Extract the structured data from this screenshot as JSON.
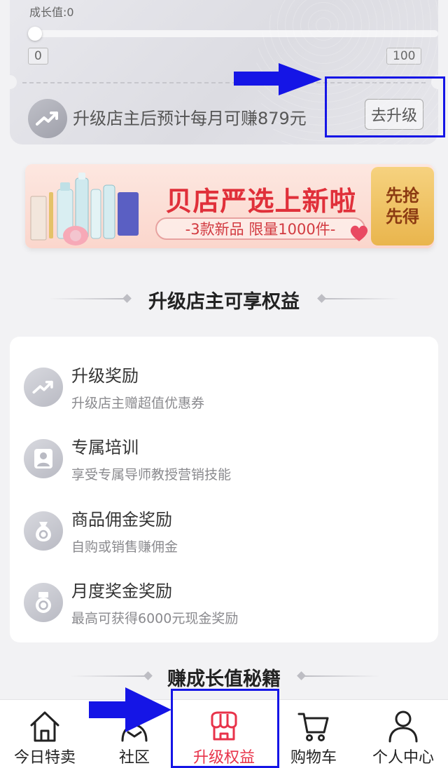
{
  "growth": {
    "label": "成长值:0",
    "value": 0,
    "scale_min": "0",
    "scale_max": "100",
    "earn_text": "升级店主后预计每月可赚879元",
    "upgrade_label": "去升级"
  },
  "banner": {
    "title": "贝店严选上新啦",
    "subtitle": "-3款新品 限量1000件-",
    "ticket": "先抢\n先得",
    "ticket_line1": "先抢",
    "ticket_line2": "先得"
  },
  "benefits_section": {
    "title": "升级店主可享权益",
    "items": [
      {
        "title": "升级奖励",
        "desc": "升级店主赠超值优惠券",
        "icon": "trend-up-icon"
      },
      {
        "title": "专属培训",
        "desc": "享受专属导师教授营销技能",
        "icon": "person-icon"
      },
      {
        "title": "商品佣金奖励",
        "desc": "自购或销售赚佣金",
        "icon": "money-bag-icon"
      },
      {
        "title": "月度奖金奖励",
        "desc": "最高可获得6000元现金奖励",
        "icon": "medal-icon"
      }
    ]
  },
  "secrets_section": {
    "title": "赚成长值秘籍"
  },
  "nav": {
    "items": [
      {
        "label": "今日特卖",
        "icon": "home-icon",
        "active": false
      },
      {
        "label": "社区",
        "icon": "community-icon",
        "active": false
      },
      {
        "label": "升级权益",
        "icon": "shop-icon",
        "active": true
      },
      {
        "label": "购物车",
        "icon": "cart-icon",
        "active": false
      },
      {
        "label": "个人中心",
        "icon": "user-icon",
        "active": false
      }
    ]
  },
  "colors": {
    "accent": "#e8334a",
    "annotation": "#1515e6",
    "banner_red": "#e0303a"
  }
}
